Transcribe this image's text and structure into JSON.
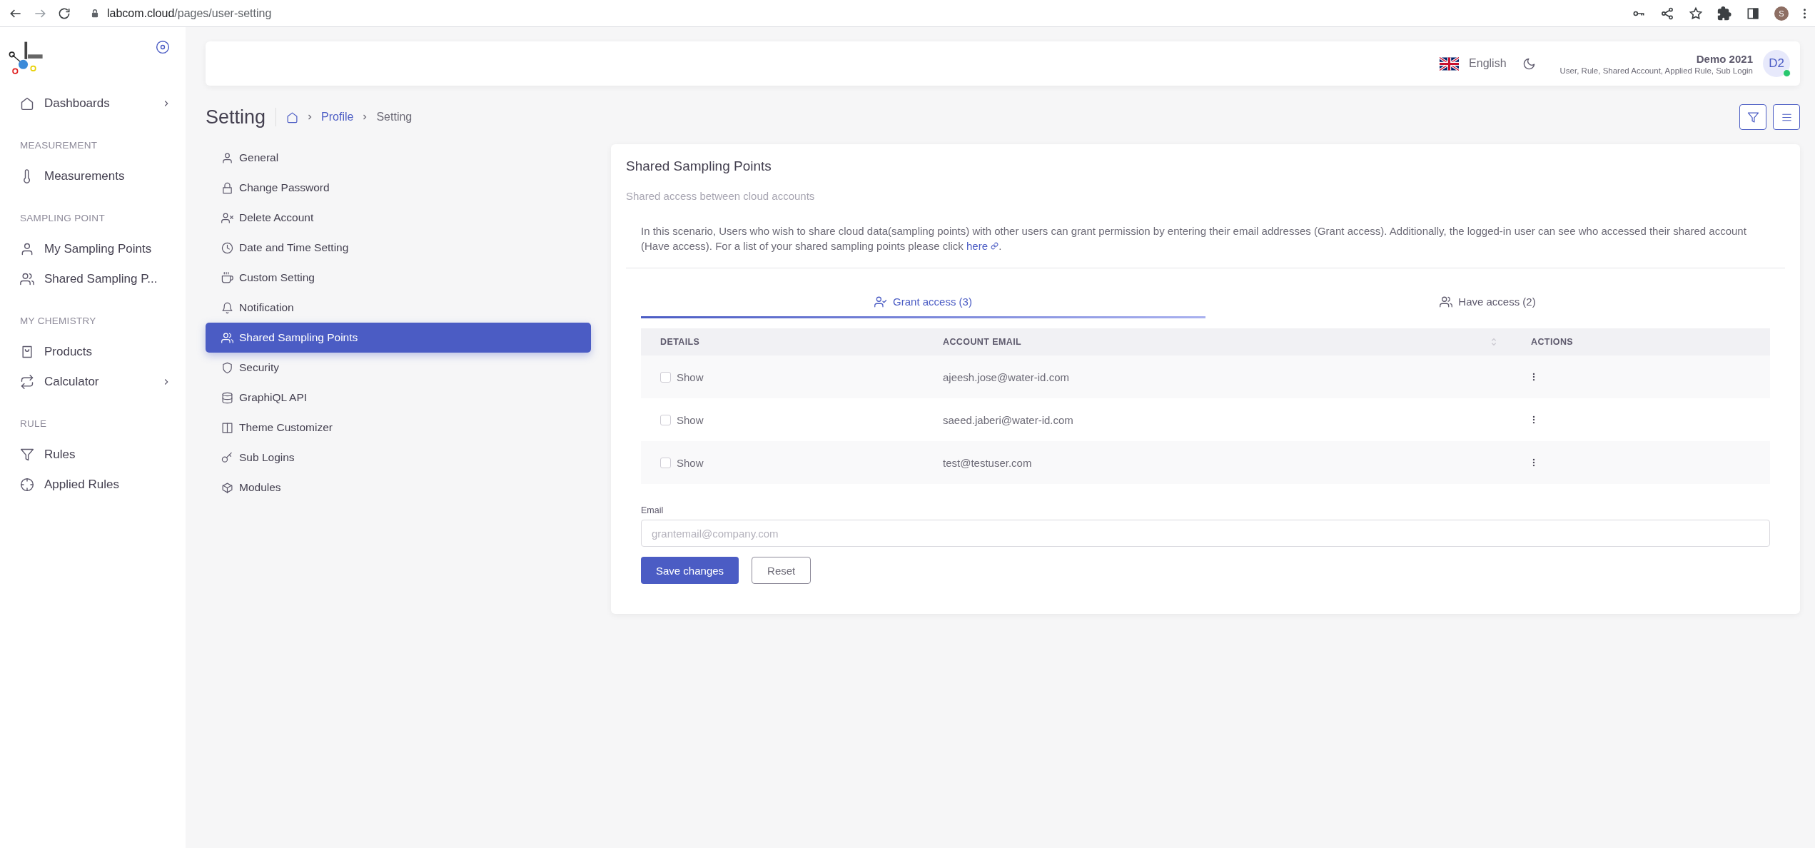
{
  "browser": {
    "url_host": "labcom.cloud",
    "url_path": "/pages/user-setting",
    "profile_initial": "S"
  },
  "sidebar": {
    "items": [
      {
        "kind": "link",
        "label": "Dashboards",
        "has_submenu": true
      },
      {
        "kind": "heading",
        "label": "MEASUREMENT"
      },
      {
        "kind": "link",
        "label": "Measurements",
        "has_submenu": false
      },
      {
        "kind": "heading",
        "label": "SAMPLING POINT"
      },
      {
        "kind": "link",
        "label": "My Sampling Points",
        "has_submenu": false
      },
      {
        "kind": "link",
        "label": "Shared Sampling P...",
        "has_submenu": false
      },
      {
        "kind": "heading",
        "label": "MY CHEMISTRY"
      },
      {
        "kind": "link",
        "label": "Products",
        "has_submenu": false
      },
      {
        "kind": "link",
        "label": "Calculator",
        "has_submenu": true
      },
      {
        "kind": "heading",
        "label": "RULE"
      },
      {
        "kind": "link",
        "label": "Rules",
        "has_submenu": false
      },
      {
        "kind": "link",
        "label": "Applied Rules",
        "has_submenu": false
      }
    ]
  },
  "header": {
    "language": "English",
    "user_name": "Demo 2021",
    "user_roles": "User, Rule, Shared Account, Applied Rule, Sub Login",
    "avatar": "D2",
    "online": true
  },
  "page": {
    "title": "Setting",
    "breadcrumb": [
      {
        "label": "Profile",
        "link": true
      },
      {
        "label": "Setting",
        "link": false
      }
    ]
  },
  "settings_menu": [
    {
      "label": "General",
      "selected": false
    },
    {
      "label": "Change Password",
      "selected": false
    },
    {
      "label": "Delete Account",
      "selected": false
    },
    {
      "label": "Date and Time Setting",
      "selected": false
    },
    {
      "label": "Custom Setting",
      "selected": false
    },
    {
      "label": "Notification",
      "selected": false
    },
    {
      "label": "Shared Sampling Points",
      "selected": true
    },
    {
      "label": "Security",
      "selected": false
    },
    {
      "label": "GraphiQL API",
      "selected": false
    },
    {
      "label": "Theme Customizer",
      "selected": false
    },
    {
      "label": "Sub Logins",
      "selected": false
    },
    {
      "label": "Modules",
      "selected": false
    }
  ],
  "card": {
    "title": "Shared Sampling Points",
    "subtitle": "Shared access between cloud accounts",
    "description_before": "In this scenario, Users who wish to share cloud data(sampling points) with other users can grant permission by entering their email addresses (Grant access). Additionally, the logged-in user can see who accessed their shared account (Have access). For a list of your shared sampling points please click ",
    "link_text": "here",
    "description_after": ".",
    "tabs": [
      {
        "label": "Grant access (3)",
        "selected": true
      },
      {
        "label": "Have access (2)",
        "selected": false
      }
    ],
    "table": {
      "columns": [
        "DETAILS",
        "ACCOUNT EMAIL",
        "ACTIONS"
      ],
      "rows": [
        {
          "checked": false,
          "label": "Show",
          "email": "ajeesh.jose@water-id.com"
        },
        {
          "checked": false,
          "label": "Show",
          "email": "saeed.jaberi@water-id.com"
        },
        {
          "checked": false,
          "label": "Show",
          "email": "test@testuser.com"
        }
      ]
    },
    "form": {
      "email_label": "Email",
      "email_placeholder": "grantemail@company.com",
      "buttons": [
        {
          "label": "Save changes",
          "kind": "primary"
        },
        {
          "label": "Reset",
          "kind": "outline"
        }
      ]
    }
  }
}
